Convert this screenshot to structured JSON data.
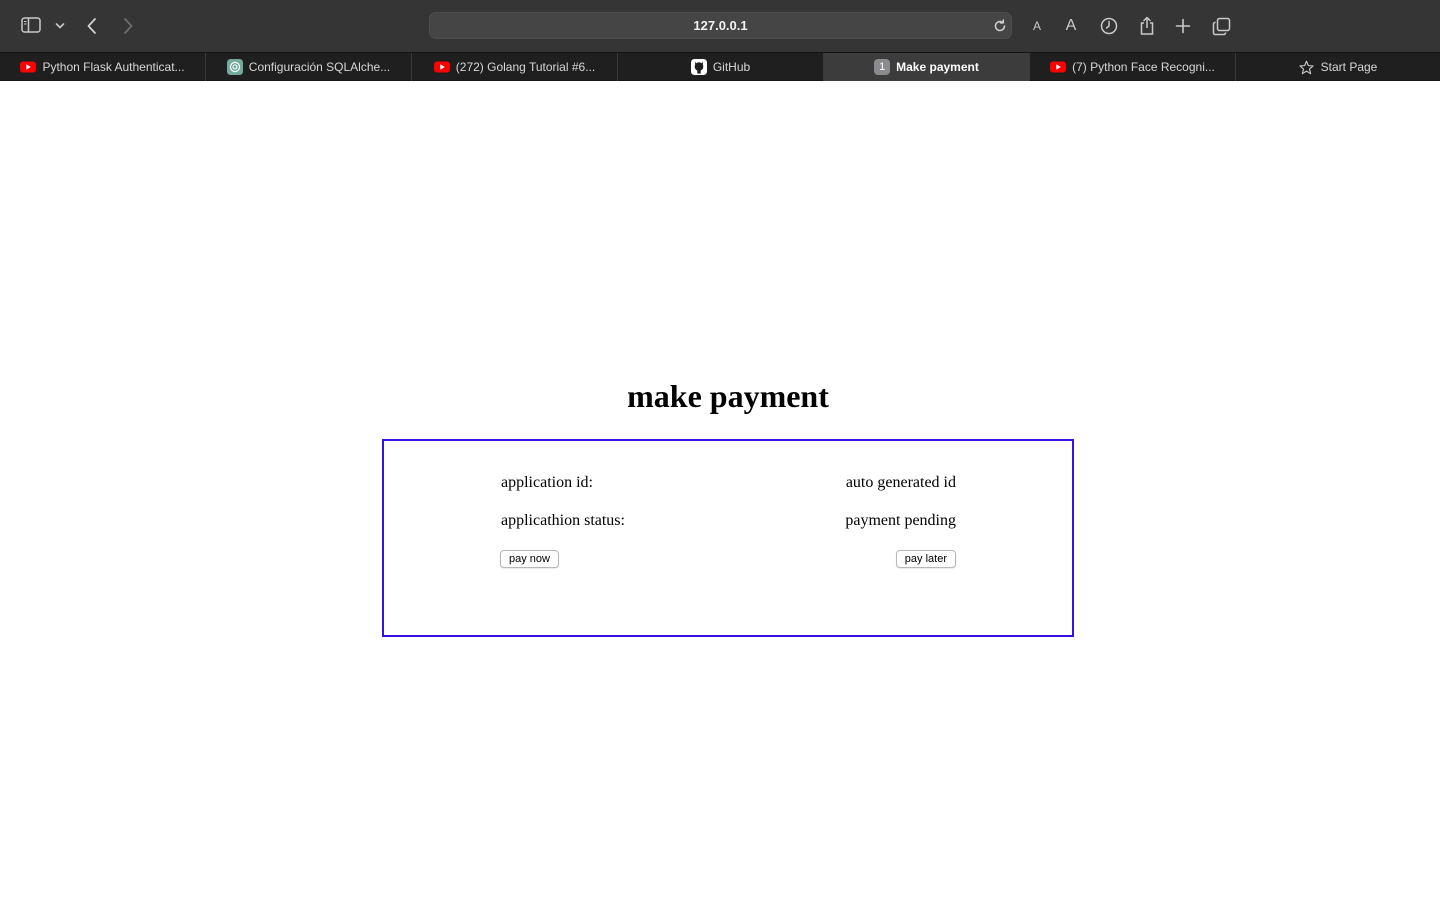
{
  "browser": {
    "url": "127.0.0.1",
    "tabs": [
      {
        "label": "Python Flask Authenticat...",
        "icon": "youtube-icon",
        "active": false
      },
      {
        "label": "Configuración SQLAlche...",
        "icon": "chatgpt-icon",
        "active": false
      },
      {
        "label": "(272) Golang Tutorial #6...",
        "icon": "youtube-icon",
        "active": false
      },
      {
        "label": "GitHub",
        "icon": "github-icon",
        "active": false
      },
      {
        "label": "Make payment",
        "icon": "number-badge-icon",
        "badge": "1",
        "active": true
      },
      {
        "label": "(7) Python Face Recogni...",
        "icon": "youtube-icon",
        "active": false
      },
      {
        "label": "Start Page",
        "icon": "star-icon",
        "active": false
      }
    ],
    "text_size_small": "A",
    "text_size_large": "A"
  },
  "page": {
    "title": "make payment",
    "fields": [
      {
        "label": "application id:",
        "value": "auto generated id"
      },
      {
        "label": "applicathion status:",
        "value": "payment pending"
      }
    ],
    "pay_now_label": "pay now",
    "pay_later_label": "pay later"
  },
  "colors": {
    "panel_border": "#3a10e5",
    "toolbar_bg": "#353535",
    "tabstrip_bg": "#1f1f1f",
    "youtube_red": "#ff0000"
  }
}
